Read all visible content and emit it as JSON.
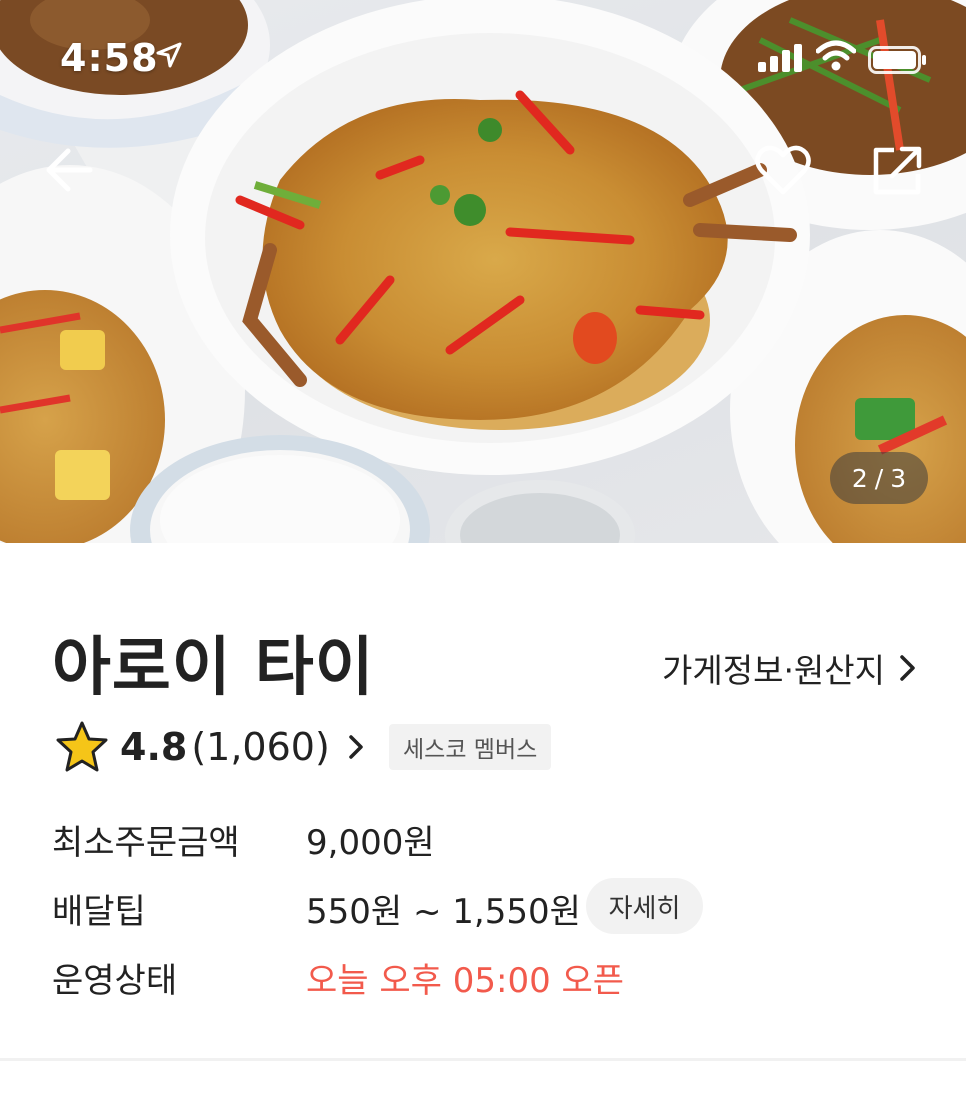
{
  "status_bar": {
    "time": "4:58",
    "icons": [
      "location-arrow-icon",
      "signal-bars-icon",
      "wifi-icon",
      "battery-icon"
    ]
  },
  "header": {
    "back_icon": "arrow-left-icon",
    "like_icon": "heart-outline-icon",
    "share_icon": "share-icon"
  },
  "gallery": {
    "current": "2",
    "separator": "/",
    "total": "3"
  },
  "store": {
    "name": "아로이 타이",
    "info_link": "가게정보·원산지",
    "rating": "4.8",
    "review_count": "(1,060)",
    "badge": "세스코 멤버스"
  },
  "details": {
    "min_order_label": "최소주문금액",
    "min_order_value": "9,000원",
    "delivery_tip_label": "배달팁",
    "delivery_tip_value": "550원 ~ 1,550원",
    "delivery_tip_button": "자세히",
    "status_label": "운영상태",
    "status_value": "오늘 오후 05:00 오픈"
  },
  "colors": {
    "accent_open": "#f25a4c",
    "star": "#f5c518",
    "badge_bg": "#f2f2f2"
  }
}
